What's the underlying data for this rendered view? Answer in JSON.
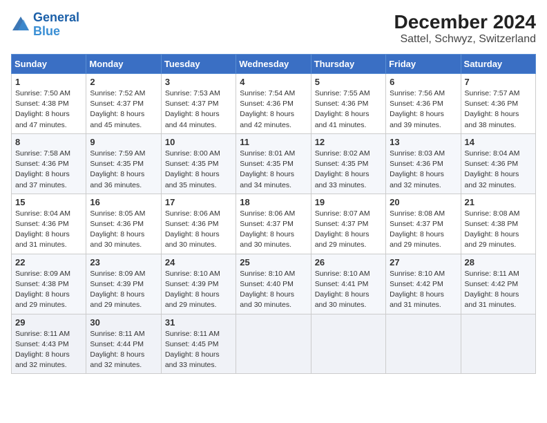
{
  "header": {
    "logo_line1": "General",
    "logo_line2": "Blue",
    "title": "December 2024",
    "subtitle": "Sattel, Schwyz, Switzerland"
  },
  "days_of_week": [
    "Sunday",
    "Monday",
    "Tuesday",
    "Wednesday",
    "Thursday",
    "Friday",
    "Saturday"
  ],
  "weeks": [
    [
      {
        "day": 1,
        "rise": "7:50 AM",
        "set": "4:38 PM",
        "daylight": "8 hours and 47 minutes."
      },
      {
        "day": 2,
        "rise": "7:52 AM",
        "set": "4:37 PM",
        "daylight": "8 hours and 45 minutes."
      },
      {
        "day": 3,
        "rise": "7:53 AM",
        "set": "4:37 PM",
        "daylight": "8 hours and 44 minutes."
      },
      {
        "day": 4,
        "rise": "7:54 AM",
        "set": "4:36 PM",
        "daylight": "8 hours and 42 minutes."
      },
      {
        "day": 5,
        "rise": "7:55 AM",
        "set": "4:36 PM",
        "daylight": "8 hours and 41 minutes."
      },
      {
        "day": 6,
        "rise": "7:56 AM",
        "set": "4:36 PM",
        "daylight": "8 hours and 39 minutes."
      },
      {
        "day": 7,
        "rise": "7:57 AM",
        "set": "4:36 PM",
        "daylight": "8 hours and 38 minutes."
      }
    ],
    [
      {
        "day": 8,
        "rise": "7:58 AM",
        "set": "4:36 PM",
        "daylight": "8 hours and 37 minutes."
      },
      {
        "day": 9,
        "rise": "7:59 AM",
        "set": "4:35 PM",
        "daylight": "8 hours and 36 minutes."
      },
      {
        "day": 10,
        "rise": "8:00 AM",
        "set": "4:35 PM",
        "daylight": "8 hours and 35 minutes."
      },
      {
        "day": 11,
        "rise": "8:01 AM",
        "set": "4:35 PM",
        "daylight": "8 hours and 34 minutes."
      },
      {
        "day": 12,
        "rise": "8:02 AM",
        "set": "4:35 PM",
        "daylight": "8 hours and 33 minutes."
      },
      {
        "day": 13,
        "rise": "8:03 AM",
        "set": "4:36 PM",
        "daylight": "8 hours and 32 minutes."
      },
      {
        "day": 14,
        "rise": "8:04 AM",
        "set": "4:36 PM",
        "daylight": "8 hours and 32 minutes."
      }
    ],
    [
      {
        "day": 15,
        "rise": "8:04 AM",
        "set": "4:36 PM",
        "daylight": "8 hours and 31 minutes."
      },
      {
        "day": 16,
        "rise": "8:05 AM",
        "set": "4:36 PM",
        "daylight": "8 hours and 30 minutes."
      },
      {
        "day": 17,
        "rise": "8:06 AM",
        "set": "4:36 PM",
        "daylight": "8 hours and 30 minutes."
      },
      {
        "day": 18,
        "rise": "8:06 AM",
        "set": "4:37 PM",
        "daylight": "8 hours and 30 minutes."
      },
      {
        "day": 19,
        "rise": "8:07 AM",
        "set": "4:37 PM",
        "daylight": "8 hours and 29 minutes."
      },
      {
        "day": 20,
        "rise": "8:08 AM",
        "set": "4:37 PM",
        "daylight": "8 hours and 29 minutes."
      },
      {
        "day": 21,
        "rise": "8:08 AM",
        "set": "4:38 PM",
        "daylight": "8 hours and 29 minutes."
      }
    ],
    [
      {
        "day": 22,
        "rise": "8:09 AM",
        "set": "4:38 PM",
        "daylight": "8 hours and 29 minutes."
      },
      {
        "day": 23,
        "rise": "8:09 AM",
        "set": "4:39 PM",
        "daylight": "8 hours and 29 minutes."
      },
      {
        "day": 24,
        "rise": "8:10 AM",
        "set": "4:39 PM",
        "daylight": "8 hours and 29 minutes."
      },
      {
        "day": 25,
        "rise": "8:10 AM",
        "set": "4:40 PM",
        "daylight": "8 hours and 30 minutes."
      },
      {
        "day": 26,
        "rise": "8:10 AM",
        "set": "4:41 PM",
        "daylight": "8 hours and 30 minutes."
      },
      {
        "day": 27,
        "rise": "8:10 AM",
        "set": "4:42 PM",
        "daylight": "8 hours and 31 minutes."
      },
      {
        "day": 28,
        "rise": "8:11 AM",
        "set": "4:42 PM",
        "daylight": "8 hours and 31 minutes."
      }
    ],
    [
      {
        "day": 29,
        "rise": "8:11 AM",
        "set": "4:43 PM",
        "daylight": "8 hours and 32 minutes."
      },
      {
        "day": 30,
        "rise": "8:11 AM",
        "set": "4:44 PM",
        "daylight": "8 hours and 32 minutes."
      },
      {
        "day": 31,
        "rise": "8:11 AM",
        "set": "4:45 PM",
        "daylight": "8 hours and 33 minutes."
      },
      null,
      null,
      null,
      null
    ]
  ]
}
